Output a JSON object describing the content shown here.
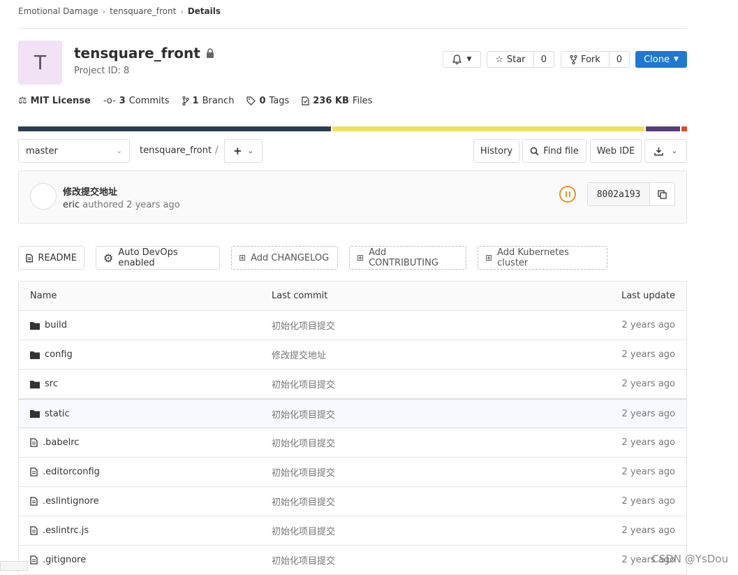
{
  "breadcrumb": {
    "items": [
      "Emotional Damage",
      "tensquare_front",
      "Details"
    ]
  },
  "project": {
    "avatar_letter": "T",
    "name": "tensquare_front",
    "id_text": "Project ID: 8"
  },
  "header_buttons": {
    "notification_icon": "bell-icon",
    "star_label": "Star",
    "star_count": "0",
    "fork_label": "Fork",
    "fork_count": "0",
    "clone_label": "Clone"
  },
  "stats": {
    "license": "MIT License",
    "commits_count": "3",
    "commits_label": "Commits",
    "branch_count": "1",
    "branch_label": "Branch",
    "tags_count": "0",
    "tags_label": "Tags",
    "files_size": "236 KB",
    "files_label": "Files"
  },
  "language_bar": {
    "segments": [
      {
        "color": "#2c3e50",
        "share": 0.468
      },
      {
        "color": "#f1e05a",
        "share": 0.467
      },
      {
        "color": "#563d7c",
        "share": 0.051
      },
      {
        "color": "#e34c26",
        "share": 0.008
      }
    ]
  },
  "toolbar": {
    "branch": "master",
    "path": "tensquare_front",
    "slash": "/",
    "history_label": "History",
    "find_file_label": "Find file",
    "web_ide_label": "Web IDE"
  },
  "commit": {
    "message": "修改提交地址",
    "author": "eric",
    "authored_text": "authored 2 years ago",
    "sha": "8002a193",
    "pipeline_status": "paused",
    "status_color": "#e59621"
  },
  "shortcuts": {
    "readme": "README",
    "autodevops": "Auto DevOps enabled",
    "changelog": "Add CHANGELOG",
    "contributing": "Add CONTRIBUTING",
    "kubernetes": "Add Kubernetes cluster"
  },
  "files": {
    "headers": {
      "name": "Name",
      "last_commit": "Last commit",
      "last_update": "Last update"
    },
    "rows": [
      {
        "name": "build",
        "type": "folder",
        "commit": "初始化项目提交",
        "updated": "2 years ago"
      },
      {
        "name": "config",
        "type": "folder",
        "commit": "修改提交地址",
        "updated": "2 years ago"
      },
      {
        "name": "src",
        "type": "folder",
        "commit": "初始化项目提交",
        "updated": "2 years ago"
      },
      {
        "name": "static",
        "type": "folder",
        "commit": "初始化项目提交",
        "updated": "2 years ago"
      },
      {
        "name": ".babelrc",
        "type": "file",
        "commit": "初始化项目提交",
        "updated": "2 years ago"
      },
      {
        "name": ".editorconfig",
        "type": "file",
        "commit": "初始化项目提交",
        "updated": "2 years ago"
      },
      {
        "name": ".eslintignore",
        "type": "file",
        "commit": "初始化项目提交",
        "updated": "2 years ago"
      },
      {
        "name": ".eslintrc.js",
        "type": "file",
        "commit": "初始化项目提交",
        "updated": "2 years ago"
      },
      {
        "name": ".gitignore",
        "type": "file",
        "commit": "初始化项目提交",
        "updated": "2 years ago"
      }
    ]
  },
  "watermark": "CSDN @YsDou"
}
